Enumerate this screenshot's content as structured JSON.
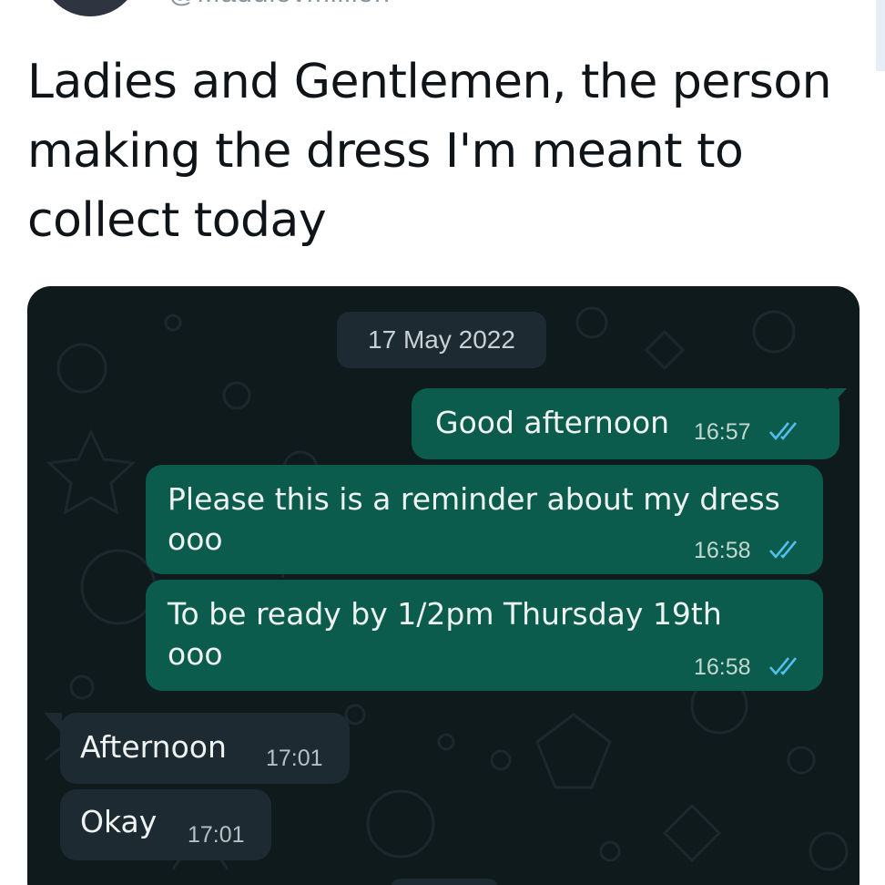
{
  "tweet": {
    "handle": "@Madulovmillion",
    "text": "Ladies and Gentlemen, the person making the dress I'm meant to collect today"
  },
  "chat": {
    "date_chip": "17 May 2022",
    "messages": [
      {
        "direction": "out",
        "text": "Good afternoon",
        "time": "16:57",
        "status": "read"
      },
      {
        "direction": "out",
        "text": "Please this is a reminder about my dress",
        "text2": "ooo",
        "time": "16:58",
        "status": "read"
      },
      {
        "direction": "out",
        "text": "To be ready by 1/2pm Thursday 19th",
        "text2": "ooo",
        "time": "16:58",
        "status": "read"
      },
      {
        "direction": "in",
        "text": "Afternoon",
        "time": "17:01"
      },
      {
        "direction": "in",
        "text": "Okay",
        "time": "17:01"
      }
    ],
    "colors": {
      "background": "#0f1a1d",
      "outgoing_bubble": "#0b5c4c",
      "incoming_bubble": "#1d2a31",
      "read_ticks": "#53bdeb"
    }
  }
}
